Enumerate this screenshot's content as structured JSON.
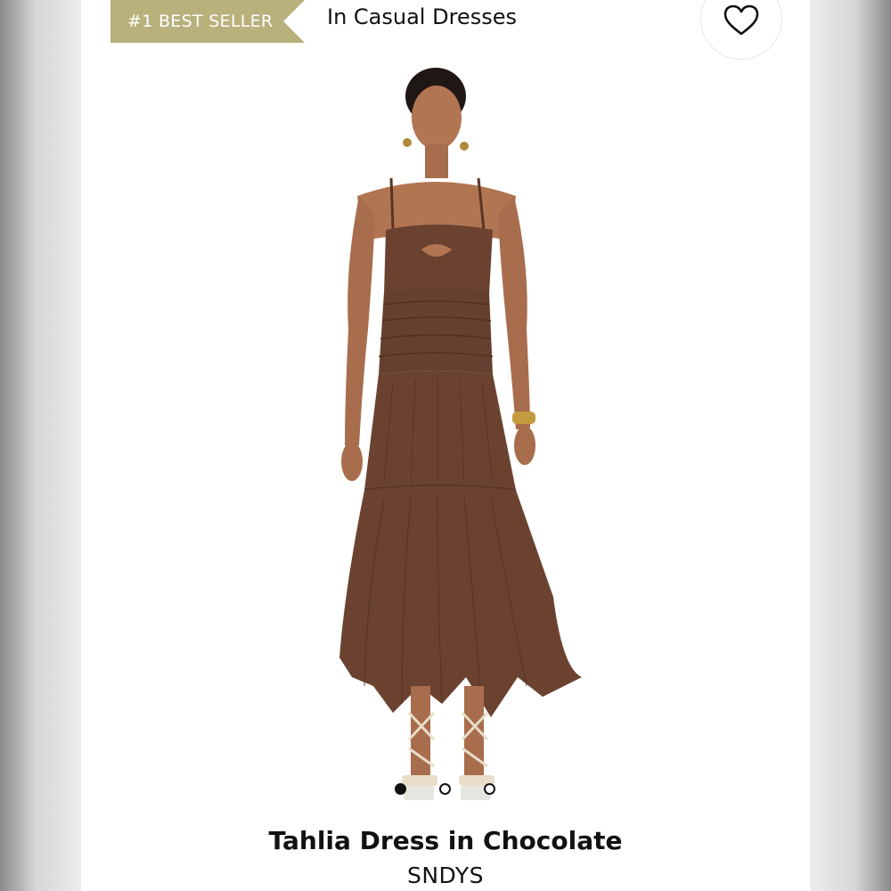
{
  "badge": {
    "label": "#1 BEST SELLER"
  },
  "category": {
    "label": "In Casual Dresses"
  },
  "wishlist": {
    "icon": "heart-outline-icon"
  },
  "product": {
    "title": "Tahlia Dress in Chocolate",
    "brand": "SNDYS",
    "dress_color": "#6b4230"
  },
  "carousel": {
    "count": 3,
    "active_index": 0
  },
  "colors": {
    "badge_bg": "#b8b17c",
    "text": "#111111"
  }
}
